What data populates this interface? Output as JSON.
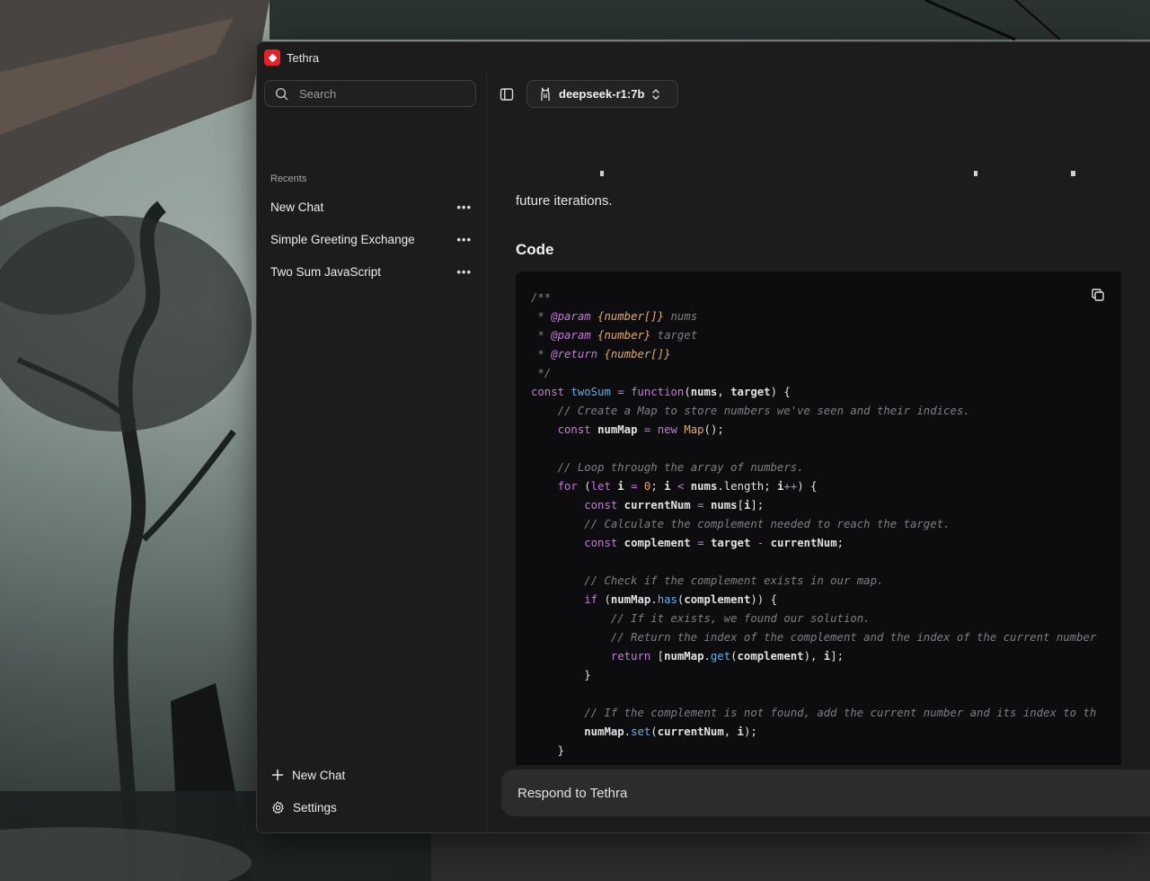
{
  "window": {
    "title": "Tethra"
  },
  "sidebar": {
    "search_placeholder": "Search",
    "recents_heading": "Recents",
    "items": [
      {
        "label": "New Chat"
      },
      {
        "label": "Simple Greeting Exchange"
      },
      {
        "label": "Two Sum JavaScript"
      }
    ],
    "new_chat_label": "New Chat",
    "settings_label": "Settings"
  },
  "header": {
    "model_label": "deepseek-r1:7b"
  },
  "chat": {
    "prev_text_tail": "future iterations.",
    "code_heading": "Code"
  },
  "composer": {
    "placeholder": "Respond to Tethra"
  },
  "colors": {
    "app_accent": "#e4212a",
    "window_bg": "#1c1c1c",
    "code_bg": "#0d0d0f",
    "comment": "#7e7e85",
    "keyword": "#c678dd",
    "function": "#61afef",
    "number": "#e5a96b"
  },
  "icons": {
    "app": "tethra-logo-icon",
    "search": "search-icon",
    "sidebar_toggle": "sidebar-toggle-icon",
    "model": "ollama-llama-icon",
    "model_chevron": "chevron-up-down-icon",
    "copy": "copy-icon",
    "more": "more-dots-icon",
    "plus": "plus-icon",
    "settings": "gear-icon"
  }
}
